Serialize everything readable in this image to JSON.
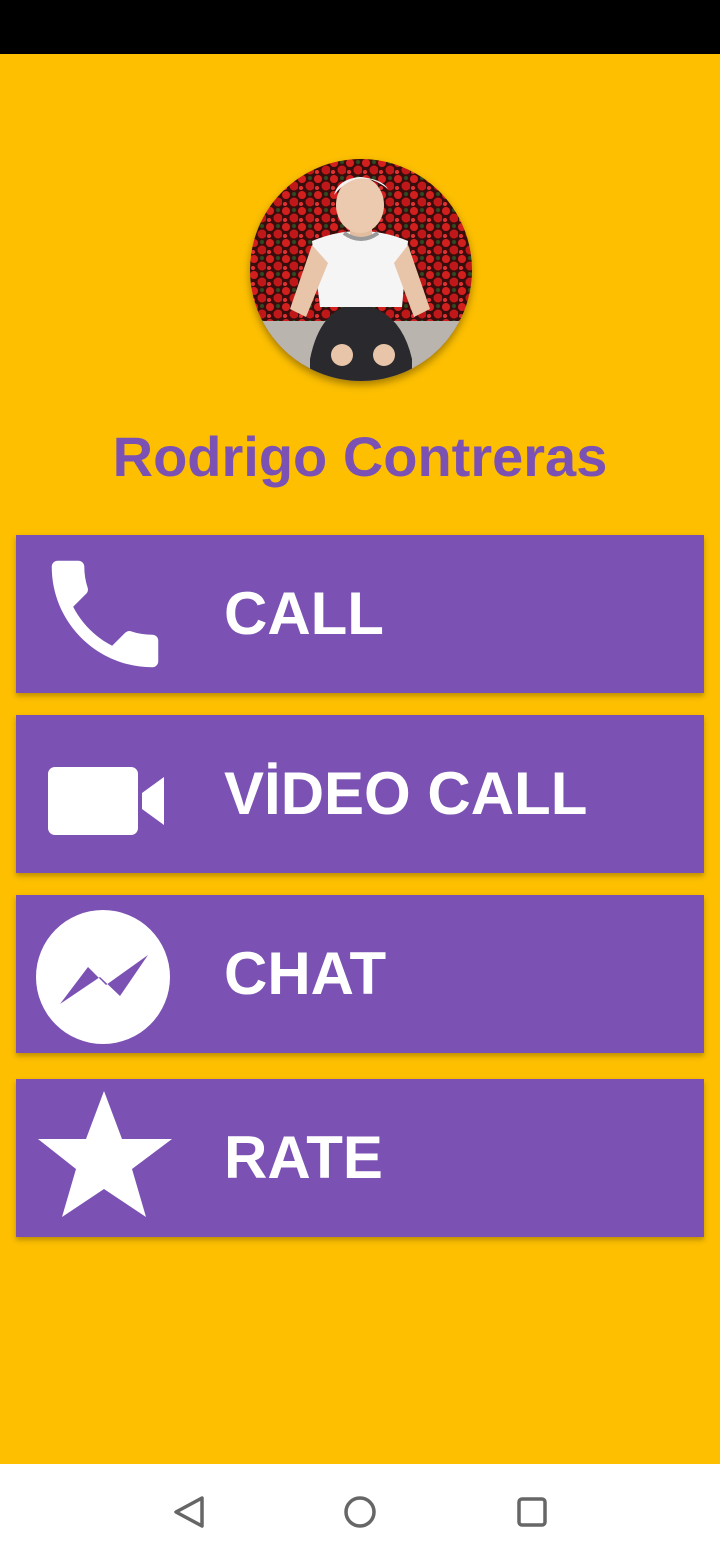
{
  "profile": {
    "name": "Rodrigo Contreras",
    "avatar_alt": "profile photo"
  },
  "actions": [
    {
      "label": "CALL",
      "icon": "phone-icon"
    },
    {
      "label": "VİDEO CALL",
      "icon": "video-camera-icon"
    },
    {
      "label": "CHAT",
      "icon": "messenger-icon"
    },
    {
      "label": "RATE",
      "icon": "star-icon"
    }
  ],
  "navigation": {
    "back": "back-icon",
    "home": "home-icon",
    "recents": "recents-icon"
  },
  "colors": {
    "background": "#FDBF00",
    "accent": "#7B52B4",
    "label": "#FFFFFF",
    "status_bar": "#000000",
    "nav_bar": "#FFFFFF"
  }
}
